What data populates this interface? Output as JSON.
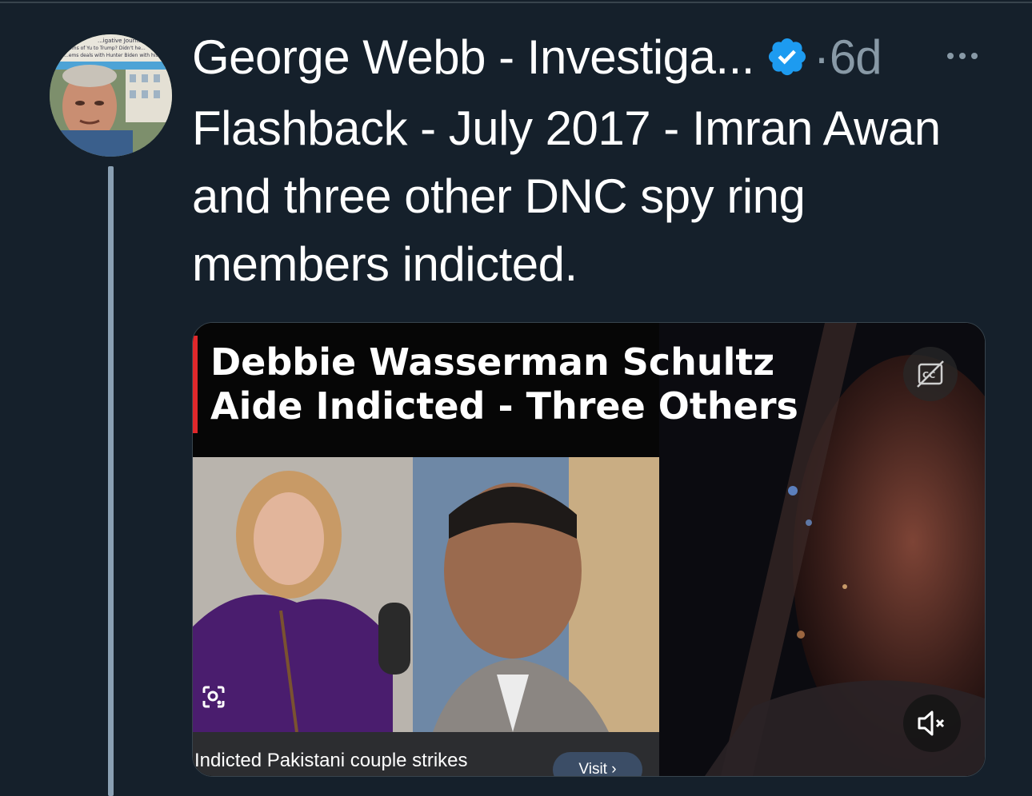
{
  "tweet": {
    "author_name": "George Webb - Investiga...",
    "separator": "·",
    "timestamp": "6d",
    "text": "Flashback - July 2017 - Imran Awan and three other DNC spy ring members indicted.",
    "avatar_caption_lines": [
      "...igative Journalist ...",
      "...ms of Yu to Trump? Didn't he...",
      "...ems deals with Hunter Biden with his..."
    ]
  },
  "media": {
    "headline_line1": "Debbie Wasserman Schultz",
    "headline_line2": "Aide Indicted - Three Others",
    "caption": "Indicted Pakistani couple strikes",
    "visit_label": "Visit ›"
  },
  "colors": {
    "background": "#15202b",
    "verified_blue": "#1d9bf0",
    "secondary_text": "#8899a6",
    "accent_red": "#e0282b"
  },
  "icons": {
    "verified": "verified-badge-icon",
    "more": "more-options-icon",
    "closed_captions": "closed-captions-off-icon",
    "mute": "volume-muted-icon",
    "lens": "image-search-icon"
  }
}
